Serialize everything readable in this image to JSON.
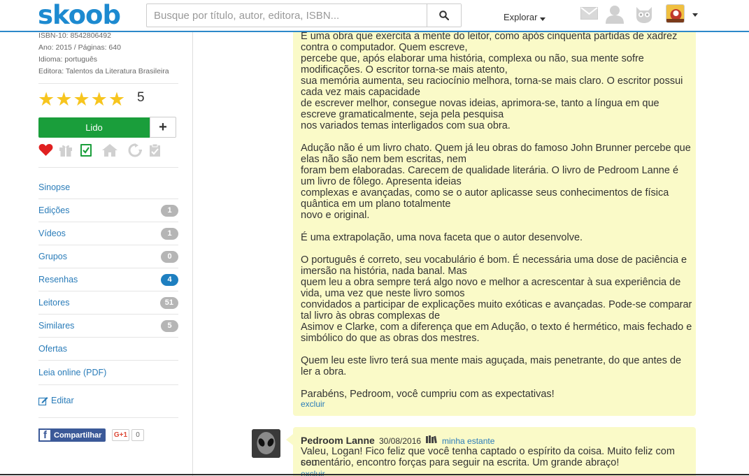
{
  "header": {
    "logo": "skoob",
    "search_placeholder": "Busque por título, autor, editora, ISBN...",
    "explore_label": "Explorar"
  },
  "book_meta": {
    "isbn10": "ISBN-10: 8542806492",
    "year_pages": "Ano: 2015 / Páginas: 640",
    "language": "Idioma: português",
    "publisher": "Editora: Talentos da Literatura Brasileira"
  },
  "rating": {
    "stars": 5,
    "value": "5"
  },
  "shelf_buttons": {
    "read_label": "Lido",
    "add_label": "+"
  },
  "nav": [
    {
      "label": "Sinopse",
      "badge": ""
    },
    {
      "label": "Edições",
      "badge": "1"
    },
    {
      "label": "Vídeos",
      "badge": "1"
    },
    {
      "label": "Grupos",
      "badge": "0"
    },
    {
      "label": "Resenhas",
      "badge": "4"
    },
    {
      "label": "Leitores",
      "badge": "51"
    },
    {
      "label": "Similares",
      "badge": "5"
    },
    {
      "label": "Ofertas",
      "badge": ""
    },
    {
      "label": "Leia online (PDF)",
      "badge": ""
    }
  ],
  "edit_label": "Editar",
  "share": {
    "facebook_label": "Compartilhar",
    "gplus_label": "G+1",
    "gplus_count": "0"
  },
  "review": {
    "lines": [
      "É uma obra que exercita a mente do leitor, como após cinquenta partidas de xadrez",
      "contra o computador. Quem escreve,",
      "percebe que, após elaborar uma história, complexa ou não, sua mente sofre",
      "modificações. O escritor torna-se mais atento,",
      "sua memória aumenta, seu raciocínio melhora, torna-se mais claro. O escritor possui",
      "cada vez mais capacidade",
      "de escrever melhor, consegue novas ideias, aprimora-se, tanto a língua em que",
      "escreve gramaticalmente, seja pela pesquisa",
      "nos variados temas interligados com sua obra.",
      "Adução não é um livro chato. Quem já leu obras do famoso John Brunner percebe que",
      "elas não são nem bem escritas, nem",
      "foram bem elaboradas. Carecem de qualidade literária. O livro de Pedroom Lanne é",
      "um livro de fôlego. Apresenta ideias",
      "complexas e avançadas, como se o autor aplicasse seus conhecimentos de física",
      "quântica em um plano totalmente",
      "novo e original.",
      "É uma extrapolação, uma nova faceta que o autor desenvolve.",
      "O português é correto, seu vocabulário é bom. É necessária uma dose de paciência e",
      "imersão na história, nada banal. Mas",
      "quem leu a obra sempre terá algo novo e melhor a acrescentar à sua experiência de",
      "vida, uma vez que neste livro somos",
      "convidados a participar de explicações muito exóticas e avançadas. Pode-se comparar",
      "tal livro às obras complexas de",
      "Asimov e Clarke, com a diferença que em Adução, o texto é hermético, mais fechado e",
      "simbólico do que as obras dos mestres.",
      "Quem leu este livro terá sua mente mais aguçada, mais penetrante, do que antes de",
      "ler a obra.",
      "Parabéns, Pedroom, você cumpriu com as expectativas!"
    ],
    "delete_label": "excluir"
  },
  "reply": {
    "author": "Pedroom Lanne",
    "date": "30/08/2016",
    "shelf_link": "minha estante",
    "lines": [
      "Valeu, Logan! Fico feliz que você tenha captado o espírito da coisa. Muito feliz com seu",
      "comentário, encontro forças para seguir na escrita. Um grande abraço!"
    ],
    "delete_label": "excluir"
  },
  "colors": {
    "brand_blue": "#1d8ad0",
    "read_green": "#1a9e3b",
    "review_bg": "#fafac8",
    "star_yellow": "#f7c51e",
    "heart_red": "#e02020"
  }
}
